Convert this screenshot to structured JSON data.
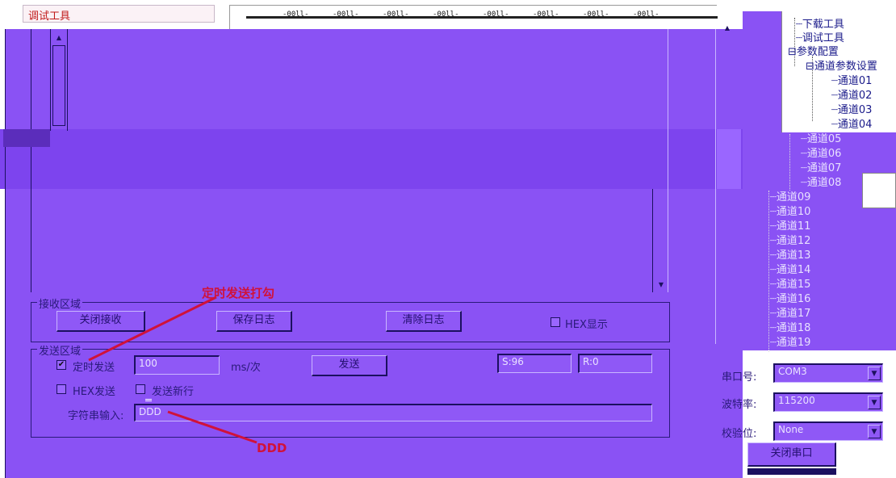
{
  "title_tab": {
    "label": "调试工具"
  },
  "top_marks": [
    "-00ll-",
    "-00ll-",
    "-00ll-",
    "-00ll-",
    "-00ll-",
    "-00ll-",
    "-00ll-",
    "-00ll-"
  ],
  "tree": {
    "items": [
      {
        "label": "下载工具"
      },
      {
        "label": "调试工具"
      },
      {
        "label": "参数配置",
        "toggle": "⊟"
      },
      {
        "label": "通道参数设置",
        "toggle": "⊟"
      },
      {
        "label": "通道01"
      },
      {
        "label": "通道02"
      },
      {
        "label": "通道03"
      },
      {
        "label": "通道04"
      },
      {
        "label": "通道05"
      },
      {
        "label": "通道06"
      },
      {
        "label": "通道07"
      },
      {
        "label": "通道08"
      },
      {
        "label": "通道09"
      },
      {
        "label": "通道10"
      },
      {
        "label": "通道11"
      },
      {
        "label": "通道12"
      },
      {
        "label": "通道13"
      },
      {
        "label": "通道14"
      },
      {
        "label": "通道15"
      },
      {
        "label": "通道16"
      },
      {
        "label": "通道17"
      },
      {
        "label": "通道18"
      },
      {
        "label": "通道19"
      }
    ]
  },
  "receive": {
    "group_label": "接收区域",
    "close_receive": "关闭接收",
    "save_log": "保存日志",
    "clear_log": "清除日志",
    "hex_display": "HEX显示",
    "hex_display_checked": false
  },
  "send": {
    "group_label": "发送区域",
    "timed_send": "定时发送",
    "timed_send_checked": true,
    "interval_value": "100",
    "interval_unit": "ms/次",
    "send_button": "发送",
    "sent_count": "S:96",
    "recv_count": "R:0",
    "hex_send": "HEX发送",
    "hex_send_checked": false,
    "send_newline": "发送新行",
    "send_newline_checked": false,
    "string_input_label": "字符串输入:",
    "string_input_value": "DDD"
  },
  "serial": {
    "port_label": "串口号:",
    "port_value": "COM3",
    "baud_label": "波特率:",
    "baud_value": "115200",
    "parity_label": "校验位:",
    "parity_value": "None",
    "close_port": "关闭串口"
  },
  "annotations": {
    "timed_send_note": "定时发送打勾",
    "input_note": "DDD"
  },
  "colors": {
    "panel": "#8a52f4",
    "annotation": "#d0123a",
    "title_text": "#c01818"
  }
}
